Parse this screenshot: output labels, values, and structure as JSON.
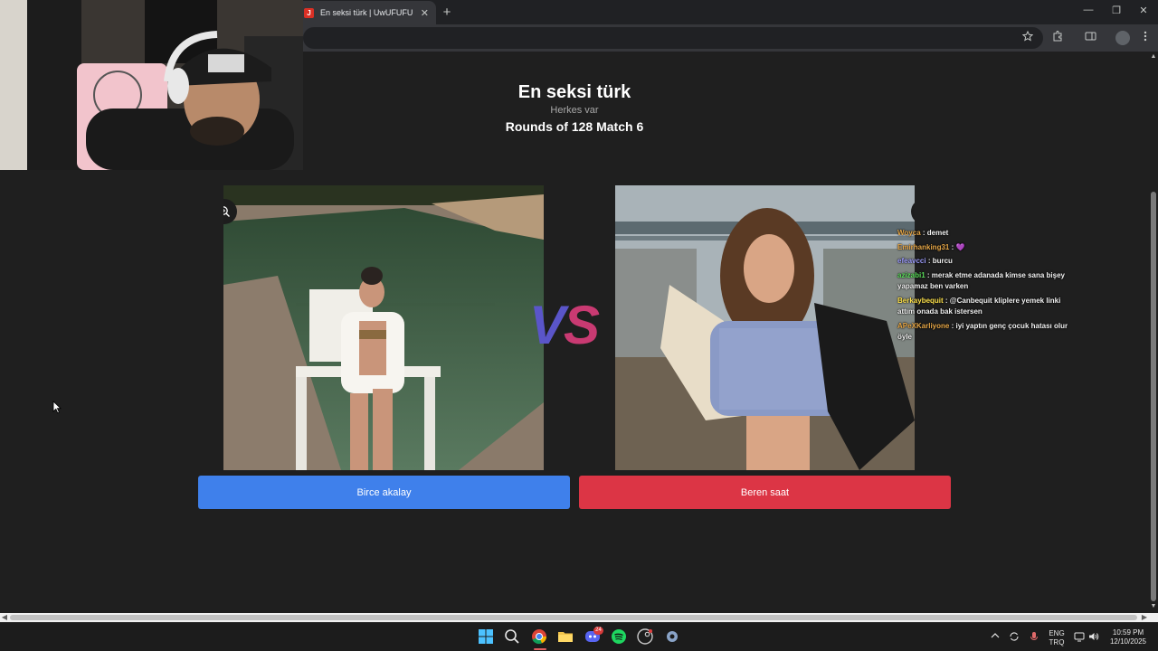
{
  "browser": {
    "tab_title": "En seksi türk | UwUFUFU",
    "tab_favicon_letter": "J",
    "tab_close": "✕",
    "new_tab": "+",
    "win_minimize": "—",
    "win_restore": "❐",
    "win_close": "✕"
  },
  "page": {
    "title": "En seksi türk",
    "subtitle": "Herkes var",
    "round_info": "Rounds of 128 Match 6",
    "vs_left": "V",
    "vs_right": "S"
  },
  "candidates": {
    "left": {
      "name": "Birce akalay",
      "color": "#3f80eb"
    },
    "right": {
      "name": "Beren saat",
      "color": "#dc3545"
    }
  },
  "chat": [
    {
      "user": "Woyca",
      "user_color": "#e8a848",
      "text": ": demet"
    },
    {
      "user": "Emirhanking31",
      "user_color": "#e8a848",
      "text": ": 💜"
    },
    {
      "user": "efeavcci",
      "user_color": "#a0a0ff",
      "text": ": burcu"
    },
    {
      "user": "azizabi1",
      "user_color": "#5ee05e",
      "text": ": merak etme adanada kimse sana bişey yapamaz ben varken"
    },
    {
      "user": "Berkaybequit",
      "user_color": "#ffe34d",
      "text": ": @Canbequit kliplere yemek linki attım onada bak istersen"
    },
    {
      "user": "APeXKarliyone",
      "user_color": "#e8a848",
      "text": ": iyi yaptın genç çocuk hatası olur öyle"
    }
  ],
  "taskbar": {
    "lang_top": "ENG",
    "lang_bottom": "TRQ",
    "time": "10:59 PM",
    "date": "12/10/2025",
    "discord_badge": "24"
  },
  "colors": {
    "page_bg": "#1f1f1f",
    "vs_v": "#5a55c9",
    "vs_s": "#c93a72"
  }
}
